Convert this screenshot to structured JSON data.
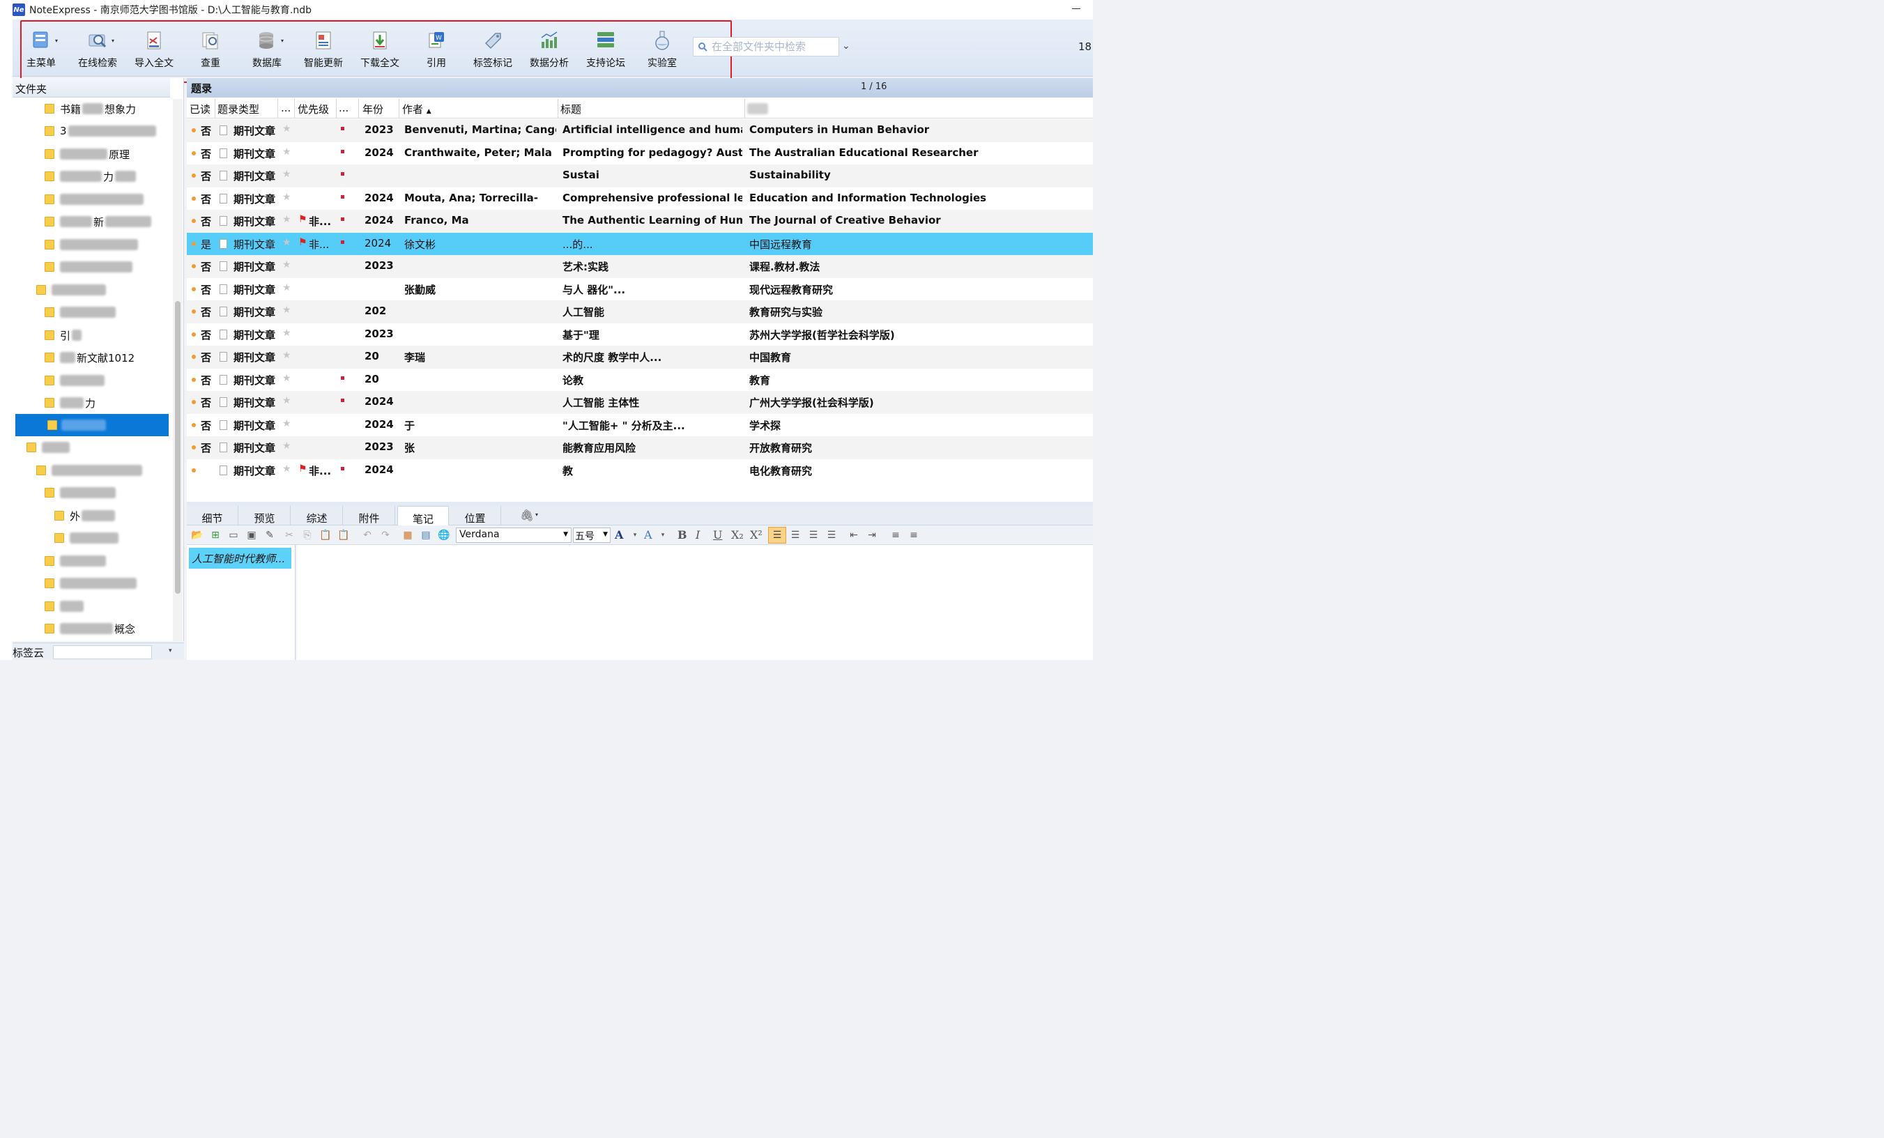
{
  "window": {
    "title": "NoteExpress - 南京师范大学图书馆版 - D:\\人工智能与教育.ndb",
    "logo": "Ne"
  },
  "toolbar": {
    "buttons": [
      {
        "label": "主菜单",
        "icon": "main-menu-icon"
      },
      {
        "label": "在线检索",
        "icon": "online-search-icon"
      },
      {
        "label": "导入全文",
        "icon": "import-fulltext-icon"
      },
      {
        "label": "查重",
        "icon": "duplicate-check-icon"
      },
      {
        "label": "数据库",
        "icon": "database-icon"
      },
      {
        "label": "智能更新",
        "icon": "smart-update-icon"
      },
      {
        "label": "下载全文",
        "icon": "download-fulltext-icon"
      },
      {
        "label": "引用",
        "icon": "cite-icon"
      },
      {
        "label": "标签标记",
        "icon": "tag-icon"
      },
      {
        "label": "数据分析",
        "icon": "chart-icon"
      },
      {
        "label": "支持论坛",
        "icon": "forum-icon"
      },
      {
        "label": "实验室",
        "icon": "flask-icon"
      }
    ],
    "search_placeholder": "在全部文件夹中检索",
    "count": "18"
  },
  "folders": {
    "header": "文件夹",
    "items": [
      "书籍",
      "想象力",
      "3",
      "原理",
      "力",
      "新",
      "引",
      "新文献1012",
      "力",
      "外",
      "概念"
    ]
  },
  "records": {
    "header": "题录",
    "page": "1 / 16",
    "columns": [
      "已读",
      "题录类型",
      "...",
      "优先级",
      "...",
      "年份",
      "作者",
      "标题",
      "期刊"
    ],
    "rows": [
      {
        "read": "否",
        "type": "期刊文章",
        "priority": "",
        "year": "2023",
        "author": "Benvenuti, Martina; Cangel",
        "title": "Artificial intelligence and human",
        "journal": "Computers in Human Behavior"
      },
      {
        "read": "否",
        "type": "期刊文章",
        "priority": "",
        "year": "2024",
        "author": "Cranthwaite, Peter; Mala",
        "title": "Prompting for pedagogy? Aust",
        "journal": "The Australian Educational Researcher"
      },
      {
        "read": "否",
        "type": "期刊文章",
        "priority": "",
        "year": "",
        "author": "",
        "title": "Sustai",
        "journal": "Sustainability"
      },
      {
        "read": "否",
        "type": "期刊文章",
        "priority": "",
        "year": "2024",
        "author": "Mouta, Ana; Torrecilla-",
        "title": "Comprehensive professional lear",
        "journal": "Education and Information Technologies"
      },
      {
        "read": "否",
        "type": "期刊文章",
        "priority": "非...",
        "year": "2024",
        "author": "Franco, Ma",
        "title": "The Authentic Learning of Huma",
        "journal": "The Journal of Creative Behavior"
      },
      {
        "read": "是",
        "type": "期刊文章",
        "priority": "非...",
        "year": "2024",
        "author": "徐文彬",
        "title": "...的...",
        "journal": "中国远程教育"
      },
      {
        "read": "否",
        "type": "期刊文章",
        "priority": "",
        "year": "2023",
        "author": "",
        "title": "艺术:实践",
        "journal": "课程.教材.教法"
      },
      {
        "read": "否",
        "type": "期刊文章",
        "priority": "",
        "year": "",
        "author": "张勤威",
        "title": "与人 器化\"...",
        "journal": "现代远程教育研究"
      },
      {
        "read": "否",
        "type": "期刊文章",
        "priority": "",
        "year": "202",
        "author": "",
        "title": "人工智能",
        "journal": "教育研究与实验"
      },
      {
        "read": "否",
        "type": "期刊文章",
        "priority": "",
        "year": "2023",
        "author": "",
        "title": "基于\"理",
        "journal": "苏州大学学报(哲学社会科学版)"
      },
      {
        "read": "否",
        "type": "期刊文章",
        "priority": "",
        "year": "20",
        "author": "李瑞",
        "title": "术的尺度 教学中人...",
        "journal": "中国教育"
      },
      {
        "read": "否",
        "type": "期刊文章",
        "priority": "",
        "year": "20",
        "author": "",
        "title": "论教",
        "journal": "教育"
      },
      {
        "read": "否",
        "type": "期刊文章",
        "priority": "",
        "year": "2024",
        "author": "",
        "title": "人工智能 主体性",
        "journal": "广州大学学报(社会科学版)"
      },
      {
        "read": "否",
        "type": "期刊文章",
        "priority": "",
        "year": "2024",
        "author": "于",
        "title": "\"人工智能+ \" 分析及主...",
        "journal": "学术探"
      },
      {
        "read": "否",
        "type": "期刊文章",
        "priority": "",
        "year": "2023",
        "author": "张",
        "title": "能教育应用风险",
        "journal": "开放教育研究"
      },
      {
        "read": "",
        "type": "期刊文章",
        "priority": "非...",
        "year": "2024",
        "author": "",
        "title": "教",
        "journal": "电化教育研究"
      }
    ]
  },
  "detail": {
    "tabs": [
      "细节",
      "预览",
      "综述",
      "附件",
      "笔记",
      "位置"
    ],
    "active_tab": "笔记",
    "font": "Verdana",
    "font_size": "五号",
    "note_title": "人工智能时代教师..."
  },
  "tags": {
    "label": "标签云"
  },
  "colors": {
    "accent_red": "#e31b23",
    "selection_blue": "#56cdf8",
    "folder_selected": "#0a78d7"
  }
}
